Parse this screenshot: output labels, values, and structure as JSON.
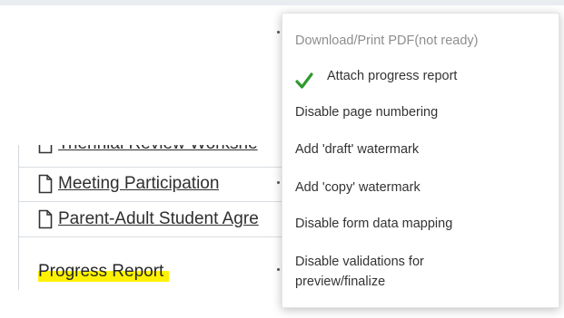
{
  "documents": {
    "items": [
      {
        "label": "Triennial Review Worksheet",
        "visible_label": "Triennial Review Workshe"
      },
      {
        "label": "Meeting Participation"
      },
      {
        "label": "Parent-Adult Student Agreement",
        "visible_label": "Parent-Adult Student Agre"
      }
    ],
    "selected": {
      "label": "Progress Report",
      "highlight": "#fff200"
    }
  },
  "menu": {
    "items": [
      {
        "label": "Download/Print PDF(not ready)",
        "disabled": true
      },
      {
        "label": "Attach progress report",
        "checked": true,
        "icon": "check-icon"
      },
      {
        "label": "Disable page numbering"
      },
      {
        "label": "Add 'draft' watermark"
      },
      {
        "label": "Add 'copy' watermark"
      },
      {
        "label": "Disable form data mapping"
      },
      {
        "label": "Disable validations for preview/finalize"
      }
    ],
    "check_color": "#2e9a2e"
  }
}
